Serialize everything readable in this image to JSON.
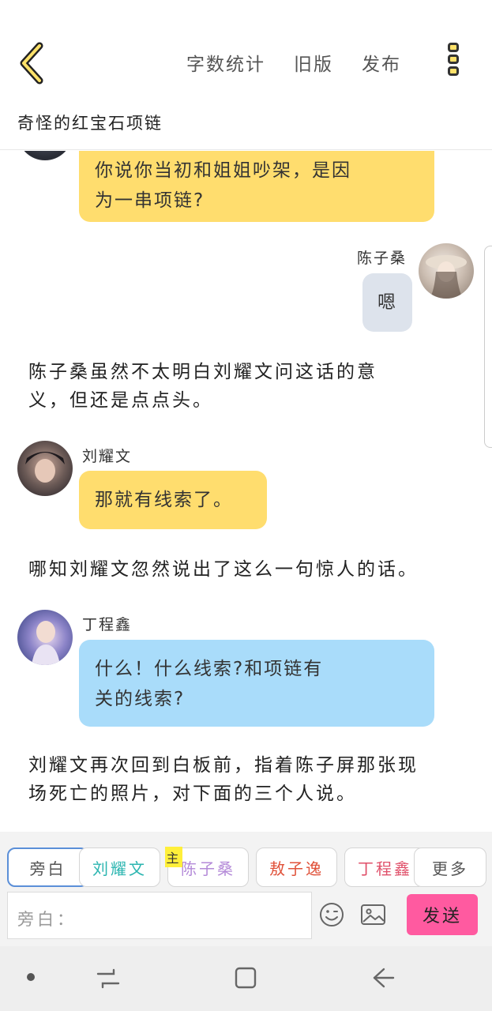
{
  "header": {
    "actions": [
      "字数统计",
      "旧版",
      "发布"
    ],
    "story_title": "奇怪的红宝石项链"
  },
  "chat": {
    "msg1": {
      "text": "你说你当初和姐姐吵架，是因为一串项链?",
      "line1": "你说你当初和姐姐吵架，是因",
      "line2": "为一串项链?"
    },
    "msg2": {
      "name": "陈子桑",
      "text": "嗯"
    },
    "narr1": {
      "line1": "陈子桑虽然不太明白刘耀文问这话的意",
      "line2": "义，但还是点点头。"
    },
    "msg3": {
      "name": "刘耀文",
      "text": "那就有线索了。"
    },
    "narr2": {
      "line1": "哪知刘耀文忽然说出了这么一句惊人的话。"
    },
    "msg4": {
      "name": "丁程鑫",
      "line1": "什么！什么线索?和项链有",
      "line2": "关的线索?"
    },
    "narr3": {
      "line1": "刘耀文再次回到白板前，指着陈子屏那张现",
      "line2": "场死亡的照片，对下面的三个人说。"
    }
  },
  "composer": {
    "roles": [
      {
        "label": "旁白",
        "color": "#555555"
      },
      {
        "label": "刘耀文",
        "color": "#2bb5b0"
      },
      {
        "label": "陈子桑",
        "color": "#b48ad8",
        "badge": "主"
      },
      {
        "label": "敖子逸",
        "color": "#e0523a"
      },
      {
        "label": "丁程鑫",
        "color": "#e0506a"
      },
      {
        "label": "更多",
        "color": "#555555"
      }
    ],
    "placeholder": "旁白：",
    "send_label": "发送"
  },
  "colors": {
    "accent_pink": "#ff5aa0",
    "bubble_yellow": "#ffdd6e",
    "bubble_blue": "#a9dcfa"
  }
}
